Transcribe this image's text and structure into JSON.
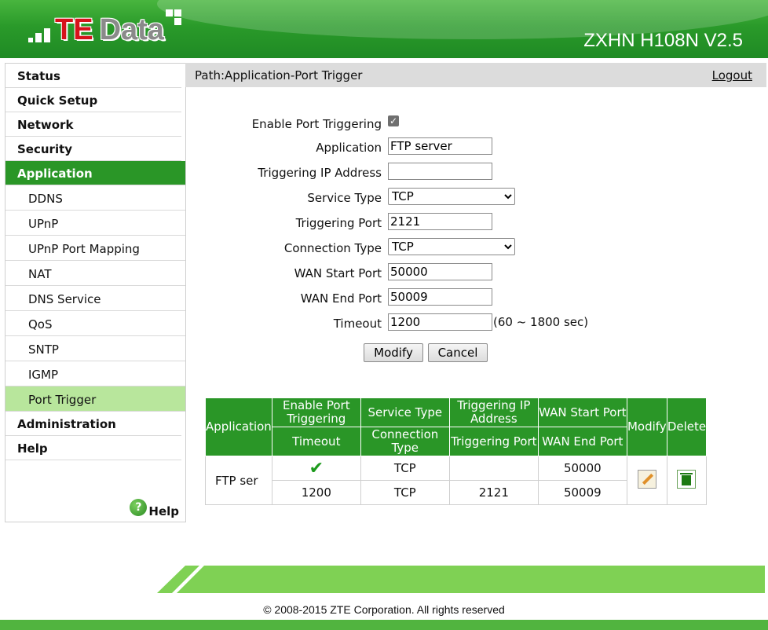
{
  "header": {
    "logo_te": "TE",
    "logo_data": "Data",
    "model": "ZXHN H108N V2.5"
  },
  "sidebar": {
    "items": [
      {
        "label": "Status",
        "level": 0
      },
      {
        "label": "Quick Setup",
        "level": 0
      },
      {
        "label": "Network",
        "level": 0
      },
      {
        "label": "Security",
        "level": 0
      },
      {
        "label": "Application",
        "level": 0,
        "active": true
      },
      {
        "label": "DDNS",
        "level": 1
      },
      {
        "label": "UPnP",
        "level": 1
      },
      {
        "label": "UPnP Port Mapping",
        "level": 1
      },
      {
        "label": "NAT",
        "level": 1
      },
      {
        "label": "DNS Service",
        "level": 1
      },
      {
        "label": "QoS",
        "level": 1
      },
      {
        "label": "SNTP",
        "level": 1
      },
      {
        "label": "IGMP",
        "level": 1
      },
      {
        "label": "Port Trigger",
        "level": 1,
        "active": true
      },
      {
        "label": "Administration",
        "level": 0
      },
      {
        "label": "Help",
        "level": 0
      }
    ],
    "help_label": "Help"
  },
  "pathbar": {
    "path": "Path:Application-Port Trigger",
    "logout": "Logout"
  },
  "form": {
    "enable_label": "Enable Port Triggering",
    "enable_checked": true,
    "application_label": "Application",
    "application_value": "FTP server",
    "trig_ip_label": "Triggering IP Address",
    "trig_ip_value": "",
    "service_type_label": "Service Type",
    "service_type_value": "TCP",
    "trig_port_label": "Triggering Port",
    "trig_port_value": "2121",
    "conn_type_label": "Connection Type",
    "conn_type_value": "TCP",
    "wan_start_label": "WAN Start Port",
    "wan_start_value": "50000",
    "wan_end_label": "WAN End Port",
    "wan_end_value": "50009",
    "timeout_label": "Timeout",
    "timeout_value": "1200",
    "timeout_hint": "(60 ~ 1800 sec)",
    "modify_label": "Modify",
    "cancel_label": "Cancel"
  },
  "table": {
    "headers_top": [
      "Application",
      "Enable Port Triggering",
      "Service Type",
      "Triggering IP Address",
      "WAN Start Port",
      "Modify",
      "Delete"
    ],
    "headers_bottom": [
      "Timeout",
      "Connection Type",
      "Triggering Port",
      "WAN End Port"
    ],
    "row": {
      "application": "FTP ser",
      "enabled_icon": "checkmark-icon",
      "service_type": "TCP",
      "trig_ip": "",
      "wan_start": "50000",
      "timeout": "1200",
      "conn_type": "TCP",
      "trig_port": "2121",
      "wan_end": "50009"
    }
  },
  "footer": {
    "copyright": "© 2008-2015 ZTE Corporation. All rights reserved"
  },
  "colors": {
    "brand_green": "#2a9627",
    "active_sub": "#b8e69c",
    "logo_red": "#d6121b"
  }
}
